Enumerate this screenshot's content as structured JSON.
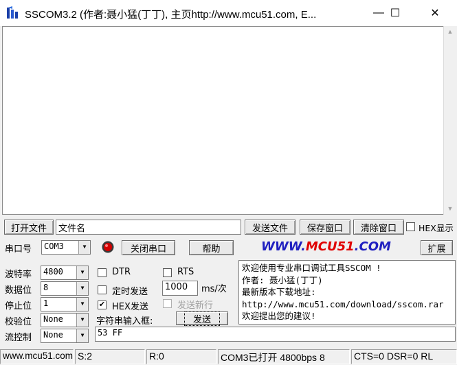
{
  "window": {
    "title": "SSCOM3.2 (作者:聂小猛(丁丁), 主页http://www.mcu51.com,  E...",
    "minimize_glyph": "—",
    "maximize_glyph": "☐",
    "close_glyph": "✕"
  },
  "file_row": {
    "open_file_label": "打开文件",
    "filename_value": "文件名",
    "send_file_label": "发送文件",
    "save_window_label": "保存窗口",
    "clear_window_label": "清除窗口",
    "hex_display_label": "HEX显示",
    "hex_display_checked": false
  },
  "port_row": {
    "port_label": "串口号",
    "port_value": "COM3",
    "close_port_label": "关闭串口",
    "help_label": "帮助",
    "logo_prefix": "WWW.",
    "logo_brand": "MCU51",
    "logo_suffix": ".COM",
    "expand_label": "扩展",
    "status_led_color": "#d40000"
  },
  "settings": {
    "baud_label": "波特率",
    "baud_value": "4800",
    "databits_label": "数据位",
    "databits_value": "8",
    "stopbits_label": "停止位",
    "stopbits_value": "1",
    "parity_label": "校验位",
    "parity_value": "None",
    "flow_label": "流控制",
    "flow_value": "None"
  },
  "options": {
    "dtr_label": "DTR",
    "dtr_checked": false,
    "rts_label": "RTS",
    "rts_checked": false,
    "timed_send_label": "定时发送",
    "timed_send_checked": false,
    "interval_value": "1000",
    "interval_unit": "ms/次",
    "hex_send_label": "HEX发送",
    "hex_send_checked": true,
    "send_newline_label": "发送新行",
    "send_newline_checked": false,
    "input_label": "字符串输入框:",
    "send_label": "发送",
    "input_value": "53 FF"
  },
  "info": {
    "line1": "欢迎使用专业串口调试工具SSCOM !",
    "line2": "作者: 聂小猛(丁丁)",
    "line3": "最新版本下载地址:",
    "line4": "http://www.mcu51.com/download/sscom.rar",
    "line5": "欢迎提出您的建议!"
  },
  "statusbar": {
    "website": "www.mcu51.com",
    "sent": "S:2",
    "received": "R:0",
    "port_status": "COM3已打开  4800bps  8",
    "signals": "CTS=0 DSR=0 RL"
  },
  "icons": {
    "app": "sscom-app-icon",
    "led": "status-led-icon"
  }
}
